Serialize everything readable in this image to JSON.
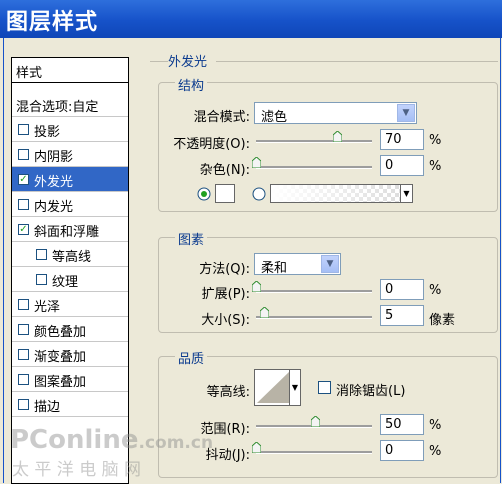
{
  "window": {
    "title": "图层样式"
  },
  "sidebar": {
    "header": "样式",
    "items": [
      {
        "label": "混合选项:自定",
        "checkbox": false,
        "checked": false,
        "indent": 0,
        "selected": false
      },
      {
        "label": "投影",
        "checkbox": true,
        "checked": false,
        "indent": 0,
        "selected": false
      },
      {
        "label": "内阴影",
        "checkbox": true,
        "checked": false,
        "indent": 0,
        "selected": false
      },
      {
        "label": "外发光",
        "checkbox": true,
        "checked": true,
        "indent": 0,
        "selected": true
      },
      {
        "label": "内发光",
        "checkbox": true,
        "checked": false,
        "indent": 0,
        "selected": false
      },
      {
        "label": "斜面和浮雕",
        "checkbox": true,
        "checked": true,
        "indent": 0,
        "selected": false
      },
      {
        "label": "等高线",
        "checkbox": true,
        "checked": false,
        "indent": 1,
        "selected": false
      },
      {
        "label": "纹理",
        "checkbox": true,
        "checked": false,
        "indent": 1,
        "selected": false
      },
      {
        "label": "光泽",
        "checkbox": true,
        "checked": false,
        "indent": 0,
        "selected": false
      },
      {
        "label": "颜色叠加",
        "checkbox": true,
        "checked": false,
        "indent": 0,
        "selected": false
      },
      {
        "label": "渐变叠加",
        "checkbox": true,
        "checked": false,
        "indent": 0,
        "selected": false
      },
      {
        "label": "图案叠加",
        "checkbox": true,
        "checked": false,
        "indent": 0,
        "selected": false
      },
      {
        "label": "描边",
        "checkbox": true,
        "checked": false,
        "indent": 0,
        "selected": false
      }
    ]
  },
  "panel": {
    "title": "外发光",
    "structure": {
      "title": "结构",
      "blend_mode_label": "混合模式:",
      "blend_mode_value": "滤色",
      "opacity_label": "不透明度(O):",
      "opacity_value": "70",
      "opacity_unit": "%",
      "noise_label": "杂色(N):",
      "noise_value": "0",
      "noise_unit": "%"
    },
    "elements": {
      "title": "图素",
      "method_label": "方法(Q):",
      "method_value": "柔和",
      "spread_label": "扩展(P):",
      "spread_value": "0",
      "spread_unit": "%",
      "size_label": "大小(S):",
      "size_value": "5",
      "size_unit": "像素"
    },
    "quality": {
      "title": "品质",
      "contour_label": "等高线:",
      "antialias_label": "消除锯齿(L)",
      "range_label": "范围(R):",
      "range_value": "50",
      "range_unit": "%",
      "jitter_label": "抖动(J):",
      "jitter_value": "0",
      "jitter_unit": "%"
    }
  },
  "watermark": {
    "text": "PConline",
    "suffix": ".com.cn",
    "subtext": "太 平 洋 电 脑 网"
  },
  "colors": {
    "selection": "#3167c6",
    "titlebar": "#1652c9",
    "heading": "#0a3a8e"
  }
}
